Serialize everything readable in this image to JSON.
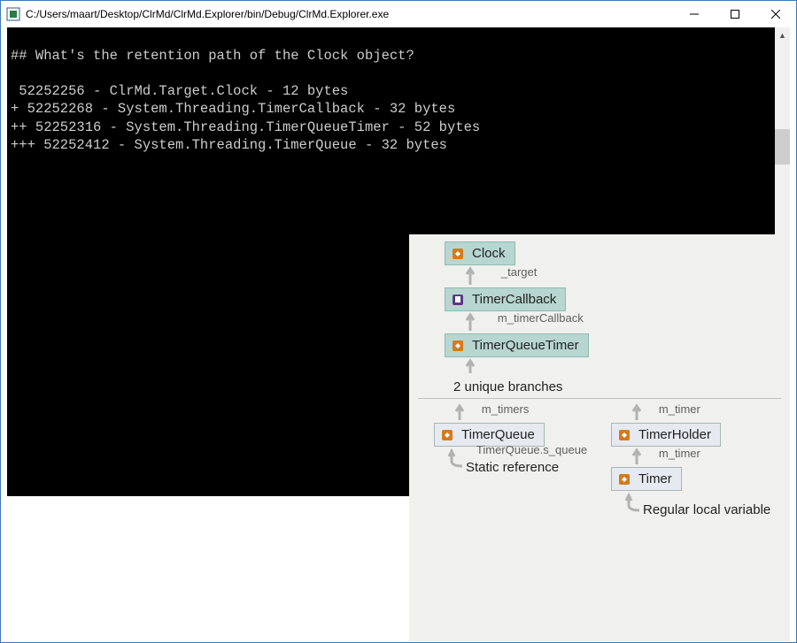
{
  "window": {
    "title": "C:/Users/maart/Desktop/ClrMd/ClrMd.Explorer/bin/Debug/ClrMd.Explorer.exe",
    "min_label": "Minimize",
    "max_label": "Maximize",
    "close_label": "Close"
  },
  "console": {
    "heading": "## What's the retention path of the Clock object?",
    "lines": [
      " 52252256 - ClrMd.Target.Clock - 12 bytes",
      "+ 52252268 - System.Threading.TimerCallback - 32 bytes",
      "++ 52252316 - System.Threading.TimerQueueTimer - 52 bytes",
      "+++ 52252412 - System.Threading.TimerQueue - 32 bytes"
    ]
  },
  "diagram": {
    "nodes": {
      "clock": "Clock",
      "timercallback": "TimerCallback",
      "timerqueuetimer": "TimerQueueTimer",
      "timerqueue": "TimerQueue",
      "timerholder": "TimerHolder",
      "timer": "Timer"
    },
    "edges": {
      "target": "_target",
      "m_timerCallback": "m_timerCallback",
      "m_timers": "m_timers",
      "m_timer": "m_timer",
      "s_queue": "TimerQueue.s_queue"
    },
    "labels": {
      "branches": "2 unique branches",
      "static_ref": "Static reference",
      "local_var": "Regular local variable"
    }
  }
}
